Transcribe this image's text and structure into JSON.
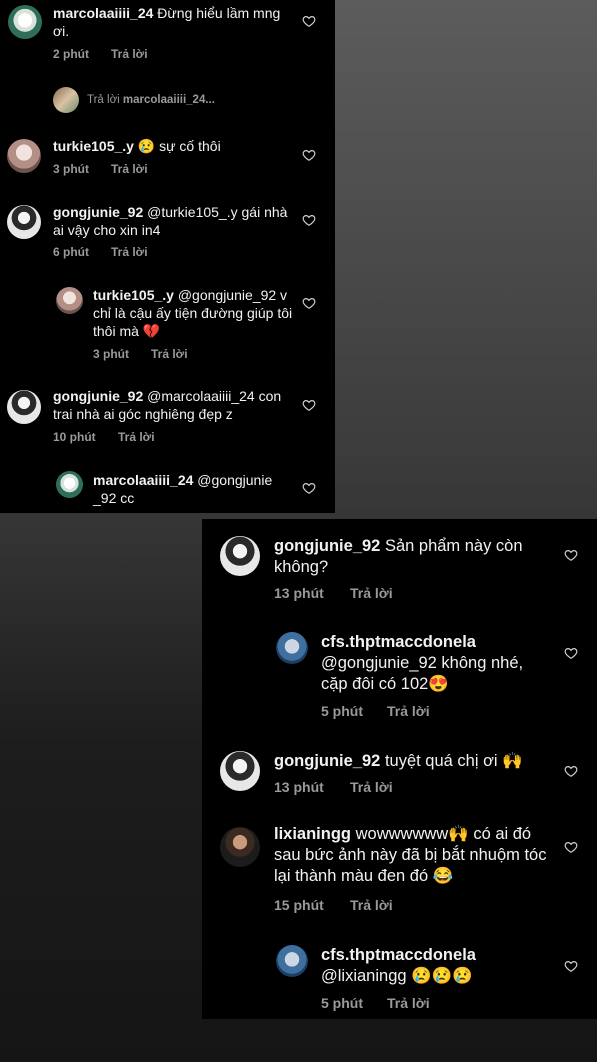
{
  "panel1": {
    "comments": [
      {
        "username": "marcolaaiiii_24",
        "text": " Đừng hiểu lầm mng ơi.",
        "time": "2 phút",
        "reply": "Trả lời"
      },
      {
        "username": "turkie105_.y",
        "text": " 😢 sự cố thôi",
        "time": "3 phút",
        "reply": "Trả lời"
      },
      {
        "username": "gongjunie_92",
        "text": " @turkie105_.y gái nhà ai vậy cho xin in4",
        "time": "6 phút",
        "reply": "Trả lời"
      },
      {
        "username": "turkie105_.y",
        "text": " @gongjunie_92 ᴠ chỉ là cậu ấy tiện đường giúp tôi thôi mà 💔",
        "time": "3 phút",
        "reply": "Trả lời"
      },
      {
        "username": "gongjunie_92",
        "text": " @marcolaaiiii_24 con trai nhà ai góc nghiêng đẹp z",
        "time": "10 phút",
        "reply": "Trả lời"
      },
      {
        "username": "marcolaaiiii_24",
        "text": " @gongjunie _92 cc",
        "time": "",
        "reply": ""
      }
    ],
    "reply_link": {
      "label": "Trả lời",
      "target": "marcolaaiiii_24..."
    }
  },
  "panel2": {
    "comments": [
      {
        "username": "gongjunie_92",
        "text": " Sản phẩm này còn không?",
        "time": "13 phút",
        "reply": "Trả lời"
      },
      {
        "username": "cfs.thptmaccdonela",
        "text": " @gongjunie_92 không nhé, cặp đôi có 102😍",
        "time": "5 phút",
        "reply": "Trả lời"
      },
      {
        "username": "gongjunie_92",
        "text": " tuyệt quá chị ơi 🙌",
        "time": "13 phút",
        "reply": "Trả lời"
      },
      {
        "username": "lixianingg",
        "text": " wowwwwww🙌 có ai đó sau bức ảnh này đã bị bắt nhuộm tóc lại thành màu đen đó 😂",
        "time": "15 phút",
        "reply": "Trả lời"
      },
      {
        "username": "cfs.thptmaccdonela",
        "text": " @lixianingg 😢😢😢",
        "time": "5 phút",
        "reply": "Trả lời"
      }
    ]
  },
  "icons": {
    "like": "heart-outline-icon"
  },
  "colors": {
    "panel_bg": "#000000",
    "text": "#f2f2f2",
    "meta": "#9a9a9a"
  }
}
